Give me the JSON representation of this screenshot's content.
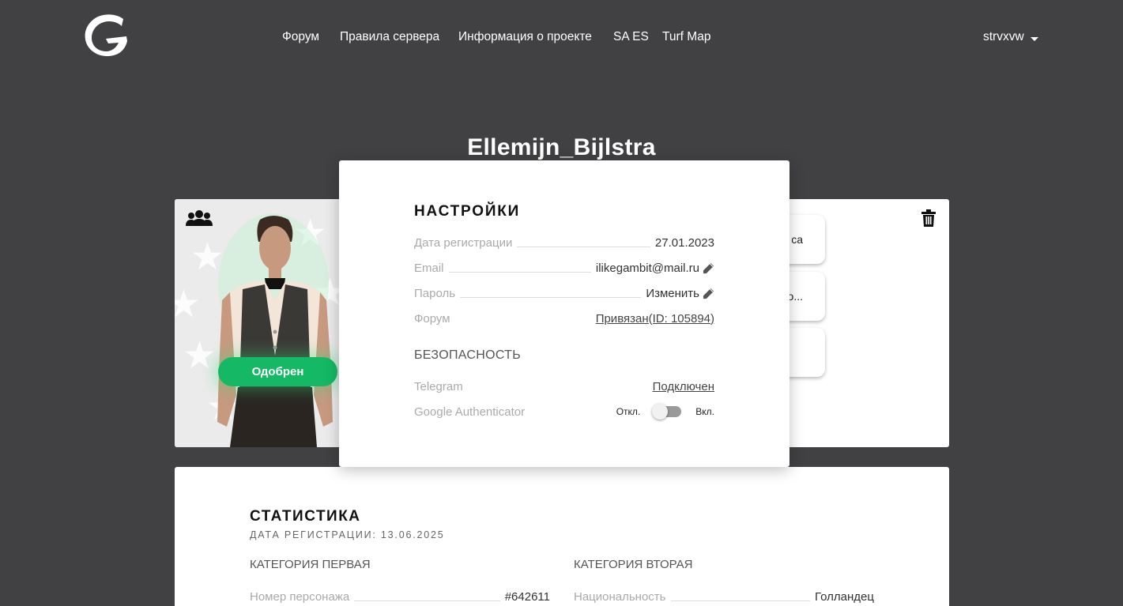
{
  "header": {
    "logo_icon": "g-logo-icon",
    "nav": [
      {
        "label": "Форум"
      },
      {
        "label": "Правила сервера"
      },
      {
        "label": "Информация о проекте"
      },
      {
        "label": "SA ES"
      },
      {
        "label": "Turf Map"
      }
    ],
    "user": {
      "name": "strvxvw",
      "icon": "caret-down-icon"
    }
  },
  "character": {
    "name": "Ellemijn_Bijlstra",
    "status_label": "Одобрен",
    "status_color": "#14b865",
    "group_icon": "group-icon",
    "delete_icon": "trash-icon"
  },
  "side_buttons": [
    {
      "label": "са"
    },
    {
      "label": "о..."
    },
    {
      "label": ""
    }
  ],
  "settings_modal": {
    "title": "НАСТРОЙКИ",
    "rows": [
      {
        "label": "Дата регистрации",
        "value": "27.01.2023"
      },
      {
        "label": "Email",
        "value": "ilikegambit@mail.ru",
        "icon": "pencil-icon"
      },
      {
        "label": "Пароль",
        "value": "Изменить",
        "icon": "pencil-icon"
      },
      {
        "label": "Форум",
        "value": "Привязан(ID: 105894)"
      }
    ],
    "security_title": "БЕЗОПАСНОСТЬ",
    "telegram": {
      "label": "Telegram",
      "value": "Подключен"
    },
    "google_auth": {
      "label": "Google Authenticator",
      "off_label": "Откл.",
      "on_label": "Вкл.",
      "enabled": false
    }
  },
  "stats": {
    "title": "СТАТИСТИКА",
    "subtitle": "ДАТА РЕГИСТРАЦИИ: 13.06.2025",
    "category_one": {
      "title": "КАТЕГОРИЯ ПЕРВАЯ",
      "rows": [
        {
          "label": "Номер персонажа",
          "value": "#642611"
        }
      ]
    },
    "category_two": {
      "title": "КАТЕГОРИЯ ВТОРАЯ",
      "rows": [
        {
          "label": "Национальность",
          "value": "Голландец"
        }
      ]
    }
  }
}
